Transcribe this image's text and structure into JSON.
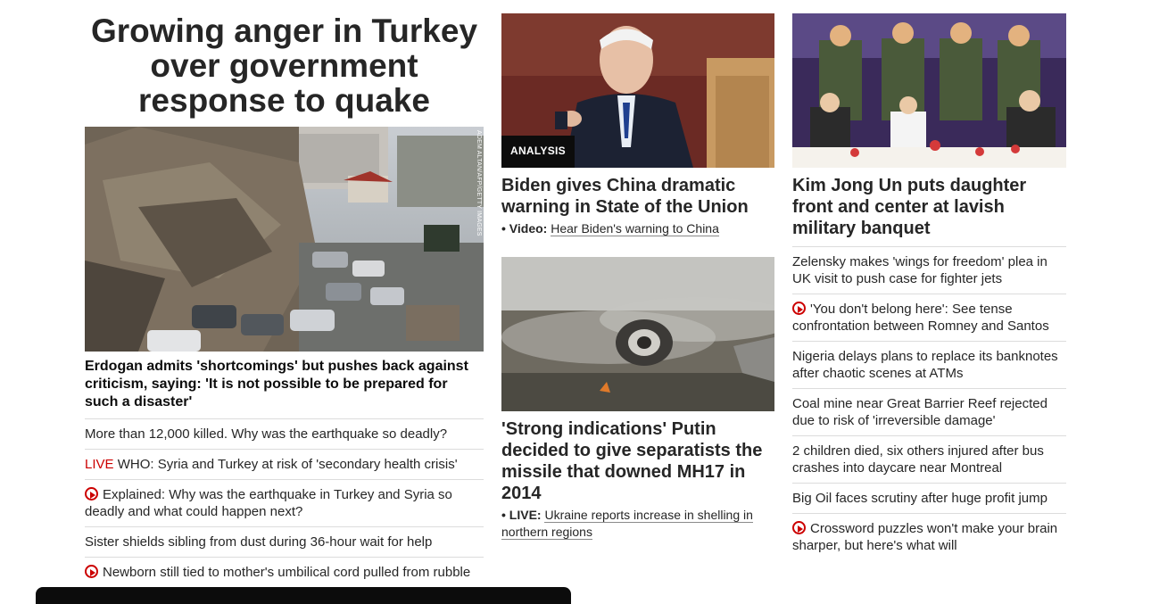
{
  "lead": {
    "headline": "Growing anger in Turkey over government response to quake",
    "photo_credit": "Adem Altan/AFP/Getty Images",
    "subhead": "Erdogan admits 'shortcomings' but pushes back against criticism, saying: 'It is not possible to be prepared for such a disaster'",
    "items": [
      {
        "prefix": "",
        "text": "More than 12,000 killed. Why was the earthquake so deadly?",
        "video": false
      },
      {
        "prefix": "LIVE",
        "text": " WHO: Syria and Turkey at risk of 'secondary health crisis'",
        "video": false
      },
      {
        "prefix": "",
        "text": "Explained: Why was the earthquake in Turkey and Syria so deadly and what could happen next?",
        "video": true
      },
      {
        "prefix": "",
        "text": "Sister shields sibling from dust during 36-hour wait for help",
        "video": false
      },
      {
        "prefix": "",
        "text": "Newborn still tied to mother's umbilical cord pulled from rubble",
        "video": true
      }
    ]
  },
  "middle": {
    "card1": {
      "badge": "ANALYSIS",
      "title": "Biden gives China dramatic warning in State of the Union",
      "link_prefix": "• Video:",
      "link_text": "Hear Biden's warning to China"
    },
    "card2": {
      "title": "'Strong indications' Putin decided to give separatists the missile that downed MH17 in 2014",
      "link_prefix": "• LIVE:",
      "link_text": "Ukraine reports increase in shelling in northern regions"
    }
  },
  "right": {
    "card_title": "Kim Jong Un puts daughter front and center at lavish military banquet",
    "items": [
      {
        "text": "Zelensky makes 'wings for freedom' plea in UK visit to push case for fighter jets",
        "video": false
      },
      {
        "text": "'You don't belong here': See tense confrontation between Romney and Santos",
        "video": true
      },
      {
        "text": "Nigeria delays plans to replace its banknotes after chaotic scenes at ATMs",
        "video": false
      },
      {
        "text": "Coal mine near Great Barrier Reef rejected due to risk of 'irreversible damage'",
        "video": false
      },
      {
        "text": "2 children died, six others injured after bus crashes into daycare near Montreal",
        "video": false
      },
      {
        "text": "Big Oil faces scrutiny after huge profit jump",
        "video": false
      },
      {
        "text": "Crossword puzzles won't make your brain sharper, but here's what will",
        "video": true
      }
    ]
  },
  "colors": {
    "live": "#cc0000",
    "text": "#0c0c0c",
    "divider": "#dcdcdc"
  }
}
